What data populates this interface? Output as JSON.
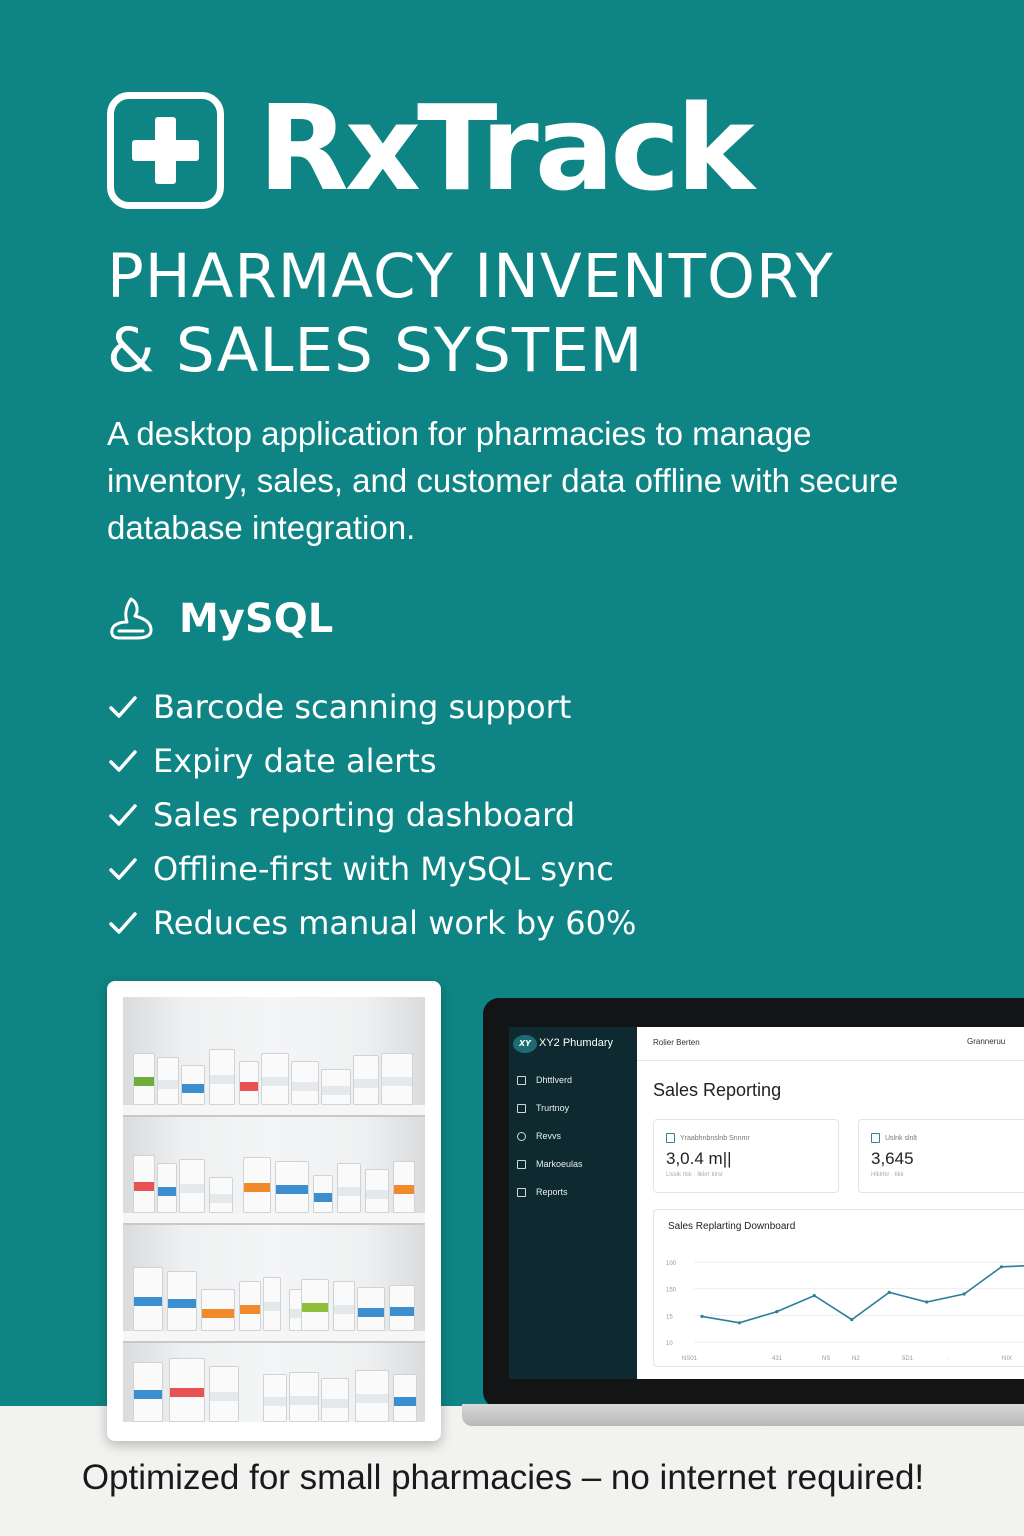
{
  "brand": {
    "name": "RxTrack"
  },
  "headline": {
    "line1": "PHARMACY INVENTORY",
    "line2": "& SALES SYSTEM"
  },
  "description": "A desktop application for pharmacies to manage inventory, sales, and customer data offline with secure database integration.",
  "database": {
    "label": "MySQL"
  },
  "features": [
    "Barcode scanning support",
    "Expiry date alerts",
    "Sales reporting dashboard",
    "Offline-first with MySQL sync",
    "Reduces manual work by 60%"
  ],
  "tagline": "Optimized for small pharmacies – no internet required!",
  "colors": {
    "background": "#0e8584",
    "sidebar": "#0e2a30",
    "chart_line": "#2d7f99"
  },
  "app": {
    "sidebar_title": "XY2 Phumdary",
    "logo_text": "XY",
    "nav": [
      "Dhttlverd",
      "Trurtnoy",
      "Revvs",
      "Markoeulas",
      "Reports"
    ],
    "user": "Rolier Berten",
    "top_right": "Granneruu",
    "page_title": "Sales Reporting",
    "cards": [
      {
        "label": "Yraabhnbnslnb Snnmr",
        "value": "3,0.4 m||",
        "sub": "Llsslk rlsk · llkkrr klrsr"
      },
      {
        "label": "Uslnk slnlt",
        "value": "3,645",
        "sub": "Hlklrlkr · tlkk"
      }
    ],
    "chart_data": {
      "type": "line",
      "title": "Sales Replarting Downboard",
      "y_ticks": [
        "100",
        "150",
        "15",
        "10"
      ],
      "x_ticks": [
        "NS01",
        "431",
        "NS",
        "N2",
        "5D1",
        "·",
        "NIX"
      ],
      "values": [
        22,
        14,
        28,
        48,
        18,
        52,
        40,
        50,
        84,
        86
      ]
    }
  }
}
